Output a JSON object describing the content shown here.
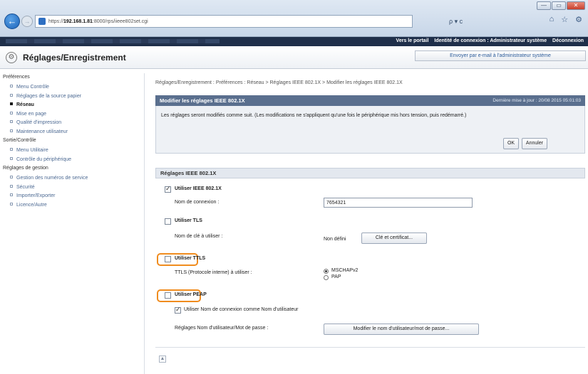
{
  "browser": {
    "url_prefix": "https://",
    "url_host": "192.168.1.81",
    "url_rest": ":8000/rps/iieee802set.cgi",
    "search_label": "ρ ▾ ᴄ",
    "window_buttons": [
      "—",
      "▭",
      "✕"
    ],
    "tool_icons": [
      "⌂",
      "☆",
      "⚙"
    ]
  },
  "topbar": {
    "portal_link": "Vers le portail",
    "login_id_label": "Identité de connexion : Administrateur système",
    "logout_link": "Déconnexion"
  },
  "header": {
    "title": "Réglages/Enregistrement",
    "email_button": "Envoyer par e-mail à l'administrateur système"
  },
  "sidebar": {
    "sections": [
      {
        "title": "Préférences",
        "items": [
          {
            "label": "Menu Contrôle"
          },
          {
            "label": "Réglages de la source papier"
          },
          {
            "label": "Réseau",
            "active": true
          },
          {
            "label": "Mise en page"
          },
          {
            "label": "Qualité d'impression"
          },
          {
            "label": "Maintenance utilisateur"
          }
        ]
      },
      {
        "title": "Sortie/Contrôle",
        "items": [
          {
            "label": "Menu Utilitaire"
          },
          {
            "label": "Contrôle du périphérique"
          }
        ]
      },
      {
        "title": "Réglages de gestion",
        "items": [
          {
            "label": "Gestion des numéros de service"
          },
          {
            "label": "Sécurité"
          },
          {
            "label": "Importer/Exporter"
          },
          {
            "label": "Licence/Autre"
          }
        ]
      }
    ]
  },
  "breadcrumb": "Réglages/Enregistrement : Préférences : Réseau > Réglages IEEE 802.1X > Modifier les réglages IEEE 802.1X",
  "panel": {
    "title": "Modifier les réglages IEEE 802.1X",
    "last_updated": "Dernière mise à jour : 20/08 2015 05:01:03",
    "message": "Les réglages seront modifiés comme suit. (Les modifications ne s'appliquent qu'une fois le périphérique mis hors tension, puis redémarré.)",
    "ok_label": "OK",
    "cancel_label": "Annuler"
  },
  "section": {
    "title": "Réglages IEEE 802.1X",
    "use_ieee": {
      "label": "Utiliser IEEE 802.1X",
      "checked": true
    },
    "login_name_label": "Nom de connexion :",
    "login_name_value": "7654321",
    "use_tls": {
      "label": "Utiliser TLS",
      "checked": false
    },
    "key_name_label": "Nom de clé à utiliser :",
    "key_name_value": "Non défini",
    "key_button": "Clé et certificat...",
    "use_ttls": {
      "label": "Utiliser TTLS",
      "checked": false
    },
    "ttls_protocol_label": "TTLS (Protocole interne) à utiliser :",
    "ttls_options": [
      {
        "label": "MSCHAPv2",
        "selected": true
      },
      {
        "label": "PAP",
        "selected": false
      }
    ],
    "use_peap": {
      "label": "Utiliser PEAP",
      "checked": false
    },
    "use_login_as_user": {
      "label": "Utiliser Nom de connexion comme Nom d'utilisateur",
      "checked": true
    },
    "user_pass_label": "Réglages Nom d'utilisateur/Mot de passe :",
    "user_pass_button": "Modifier le nom d'utilisateur/mot de passe..."
  },
  "footer_icon": "▲",
  "colors": {
    "highlight": "#f08c1e",
    "panel_header": "#5a6f8e",
    "topbar": "#1f2f4a"
  }
}
